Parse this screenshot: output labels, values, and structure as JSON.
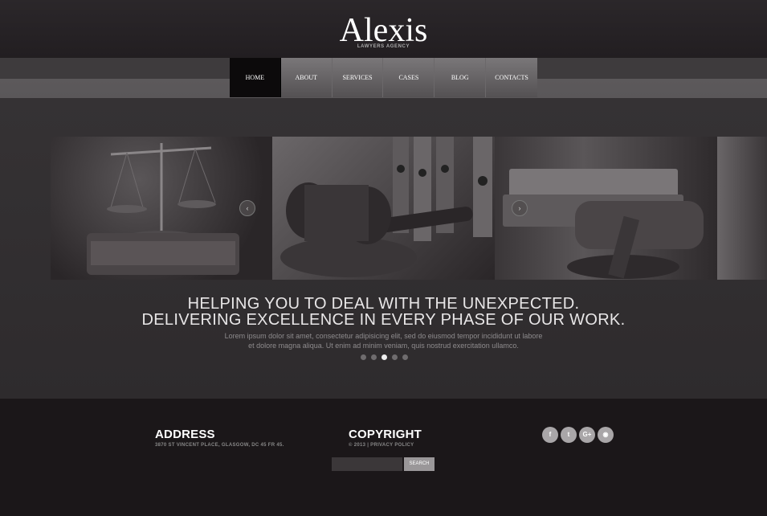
{
  "brand": {
    "name": "Alexis",
    "tagline": "LAWYERS AGENCY"
  },
  "nav": {
    "items": [
      {
        "label": "HOME",
        "active": true
      },
      {
        "label": "ABOUT"
      },
      {
        "label": "SERVICES"
      },
      {
        "label": "CASES"
      },
      {
        "label": "BLOG"
      },
      {
        "label": "CONTACTS"
      }
    ]
  },
  "slider": {
    "prev_icon": "chevron-left-icon",
    "next_icon": "chevron-right-icon",
    "prev_glyph": "‹",
    "next_glyph": "›"
  },
  "hero": {
    "headline_1": "HELPING YOU TO DEAL WITH THE UNEXPECTED.",
    "headline_2": "DELIVERING EXCELLENCE IN EVERY PHASE OF OUR WORK.",
    "text_1": "Lorem ipsum dolor sit amet, consectetur adipisicing elit, sed do eiusmod tempor incididunt ut labore",
    "text_2": "et dolore magna aliqua. Ut enim ad minim veniam, quis nostrud exercitation ullamco.",
    "dots_count": 5,
    "active_dot": 3
  },
  "footer": {
    "address_title": "ADDRESS",
    "address_text": "3870 ST VINCENT PLACE, GLASGOW, DC 45 FR 45.",
    "copyright_title": "COPYRIGHT",
    "copyright_text": "© 2013 | PRIVACY POLICY",
    "social": [
      {
        "icon": "facebook-icon",
        "glyph": "f"
      },
      {
        "icon": "twitter-icon",
        "glyph": "t"
      },
      {
        "icon": "google-plus-icon",
        "glyph": "G+"
      },
      {
        "icon": "rss-icon",
        "glyph": "◉"
      }
    ],
    "search_button": "SEARCH",
    "search_value": ""
  },
  "colors": {
    "background": "#2d2a2c",
    "footer": "#1b1719",
    "nav_active": "#0c0a0b",
    "accent": "#a9a6a8"
  }
}
